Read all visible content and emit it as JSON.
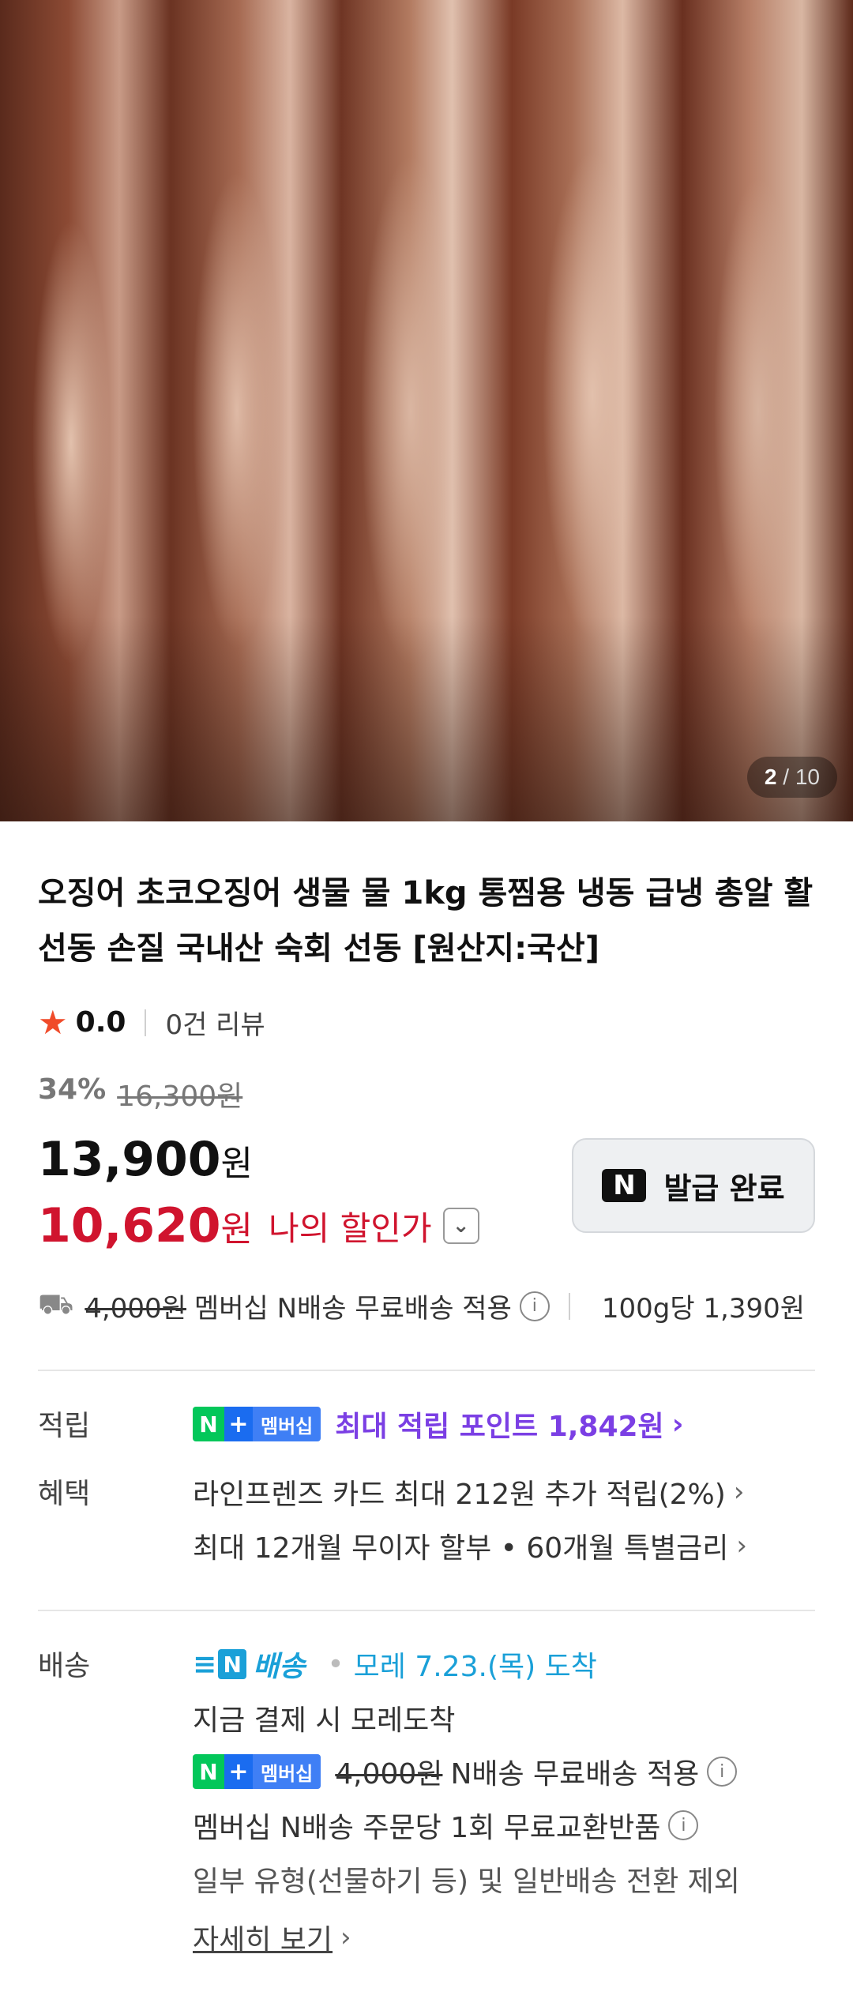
{
  "gallery": {
    "current": "2",
    "separator": "/",
    "total": "10"
  },
  "product": {
    "title": "오징어 초코오징어 생물 물 1kg 통찜용 냉동 급냉 총알 활 선동 손질 국내산 숙회 선동 [원산지:국산]",
    "rating": "0.0",
    "review_count": "0건 리뷰"
  },
  "pricing": {
    "discount_rate": "34%",
    "original_price": "16,300원",
    "sale_price": "13,900",
    "won": "원",
    "my_price": "10,620",
    "my_price_label": "나의 할인가",
    "coupon_button": "발급 완료",
    "coupon_n": "N"
  },
  "shipping_summary": {
    "fee_struck": "4,000원",
    "text": "멤버십 N배송 무료배송 적용",
    "unit_price": "100g당 1,390원"
  },
  "benefits": {
    "points_label": "적립",
    "points_text": "최대 적립 포인트 1,842원",
    "perks_label": "혜택",
    "perks": [
      "라인프렌즈 카드 최대 212원 추가 적립(2%)",
      "최대 12개월 무이자 할부 • 60개월 특별금리"
    ]
  },
  "badge": {
    "n": "N",
    "plus": "+",
    "membership": "멤버십"
  },
  "delivery": {
    "label": "배송",
    "brand": "배송",
    "brand_n": "N",
    "arrival": "모레 7.23.(목) 도착",
    "line1": "지금 결제 시 모레도착",
    "fee_struck": "4,000원",
    "free_text": "N배송 무료배송 적용",
    "exchange_text": "멤버십 N배송 주문당 1회 무료교환반품",
    "exclusion_text": "일부 유형(선물하기 등) 및 일반배송 전환 제외",
    "more": "자세히 보기"
  }
}
